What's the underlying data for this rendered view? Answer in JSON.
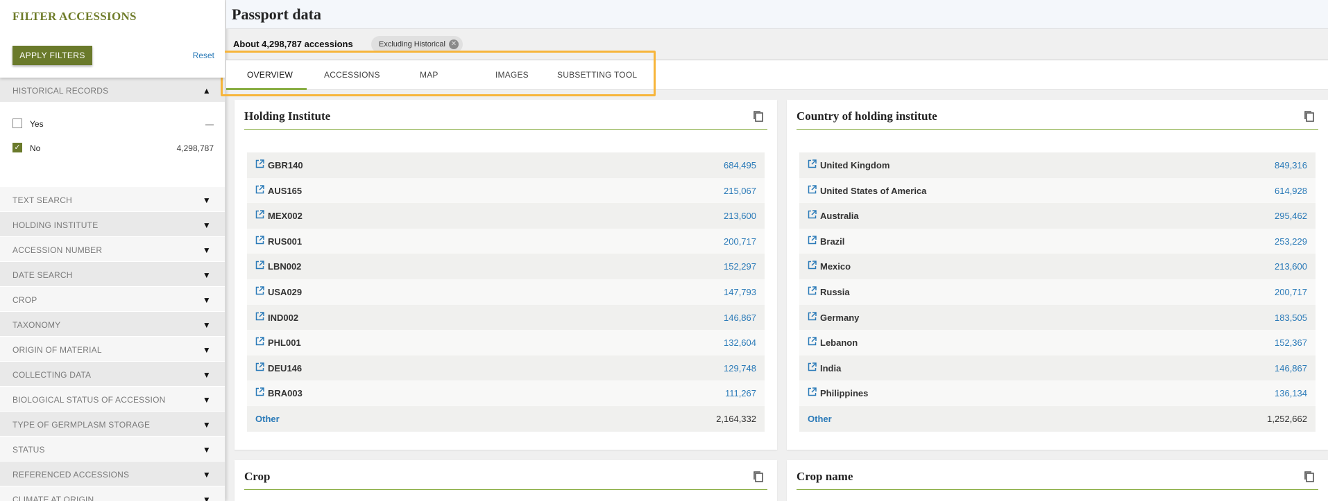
{
  "sidebar": {
    "title": "FILTER ACCESSIONS",
    "apply_label": "APPLY FILTERS",
    "reset_label": "Reset",
    "historical": {
      "label": "HISTORICAL RECORDS",
      "options": [
        {
          "label": "Yes",
          "count": "—",
          "checked": false
        },
        {
          "label": "No",
          "count": "4,298,787",
          "checked": true
        }
      ]
    },
    "sections": [
      "TEXT SEARCH",
      "HOLDING INSTITUTE",
      "ACCESSION NUMBER",
      "DATE SEARCH",
      "CROP",
      "TAXONOMY",
      "ORIGIN OF MATERIAL",
      "COLLECTING DATA",
      "BIOLOGICAL STATUS OF ACCESSION",
      "TYPE OF GERMPLASM STORAGE",
      "STATUS",
      "REFERENCED ACCESSIONS",
      "CLIMATE AT ORIGIN"
    ]
  },
  "page": {
    "title": "Passport data",
    "count": "About 4,298,787 accessions",
    "chip": "Excluding Historical"
  },
  "tabs": [
    "OVERVIEW",
    "ACCESSIONS",
    "MAP",
    "IMAGES",
    "SUBSETTING TOOL"
  ],
  "cards": [
    {
      "title": "Holding Institute",
      "rows": [
        {
          "name": "GBR140",
          "value": "684,495"
        },
        {
          "name": "AUS165",
          "value": "215,067"
        },
        {
          "name": "MEX002",
          "value": "213,600"
        },
        {
          "name": "RUS001",
          "value": "200,717"
        },
        {
          "name": "LBN002",
          "value": "152,297"
        },
        {
          "name": "USA029",
          "value": "147,793"
        },
        {
          "name": "IND002",
          "value": "146,867"
        },
        {
          "name": "PHL001",
          "value": "132,604"
        },
        {
          "name": "DEU146",
          "value": "129,748"
        },
        {
          "name": "BRA003",
          "value": "111,267"
        }
      ],
      "other": {
        "name": "Other",
        "value": "2,164,332"
      }
    },
    {
      "title": "Country of holding institute",
      "rows": [
        {
          "name": "United Kingdom",
          "value": "849,316"
        },
        {
          "name": "United States of America",
          "value": "614,928"
        },
        {
          "name": "Australia",
          "value": "295,462"
        },
        {
          "name": "Brazil",
          "value": "253,229"
        },
        {
          "name": "Mexico",
          "value": "213,600"
        },
        {
          "name": "Russia",
          "value": "200,717"
        },
        {
          "name": "Germany",
          "value": "183,505"
        },
        {
          "name": "Lebanon",
          "value": "152,367"
        },
        {
          "name": "India",
          "value": "146,867"
        },
        {
          "name": "Philippines",
          "value": "136,134"
        }
      ],
      "other": {
        "name": "Other",
        "value": "1,252,662"
      }
    },
    {
      "title": "Crop"
    },
    {
      "title": "Crop name"
    }
  ]
}
